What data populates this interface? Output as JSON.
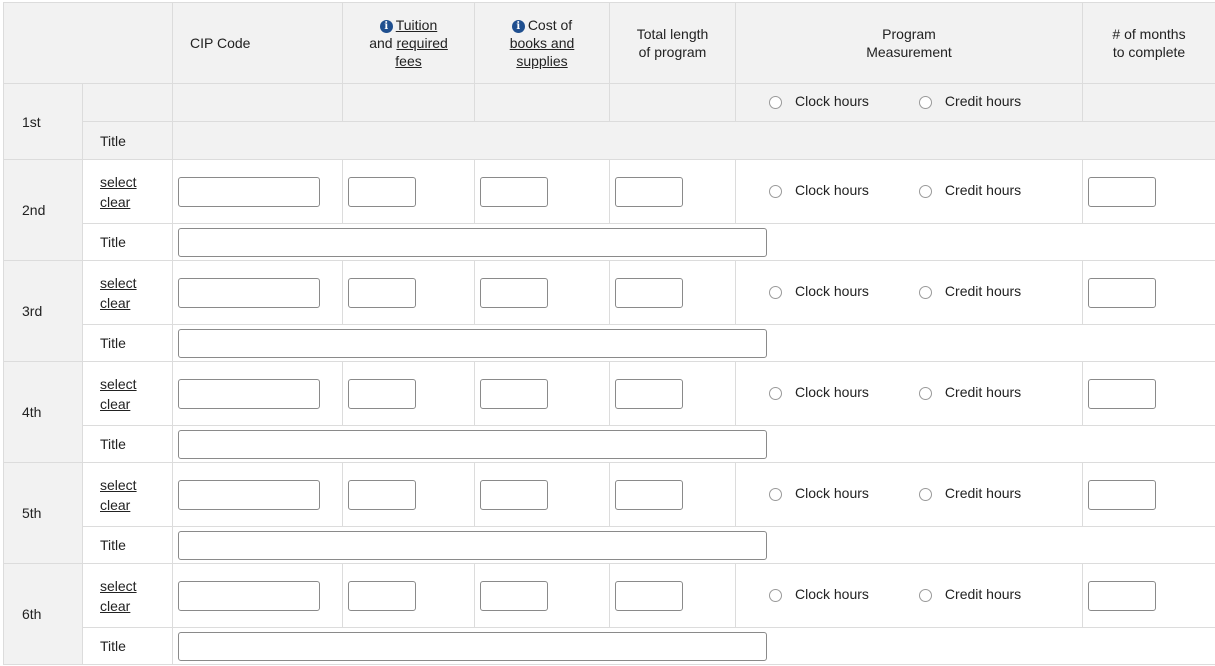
{
  "header": {
    "cip_code": "CIP Code",
    "tuition_link": "Tuition",
    "tuition_and": "and",
    "required_link": "required",
    "fees_link": "fees",
    "cost_of": "Cost of",
    "books_and_link": "books and",
    "supplies_link": "supplies",
    "total_length_1": "Total length",
    "total_length_2": "of program",
    "program_measurement_1": "Program",
    "program_measurement_2": "Measurement",
    "months_1": "# of months",
    "months_2": "to complete"
  },
  "labels": {
    "title": "Title",
    "select": "select",
    "clear": "clear",
    "clock_hours": "Clock hours",
    "credit_hours": "Credit hours"
  },
  "rows": [
    {
      "ordinal": "1st"
    },
    {
      "ordinal": "2nd"
    },
    {
      "ordinal": "3rd"
    },
    {
      "ordinal": "4th"
    },
    {
      "ordinal": "5th"
    },
    {
      "ordinal": "6th"
    }
  ],
  "colors": {
    "header_bg": "#f2f2f2",
    "border": "#dcdcdc",
    "info_icon": "#1f4f8f"
  }
}
